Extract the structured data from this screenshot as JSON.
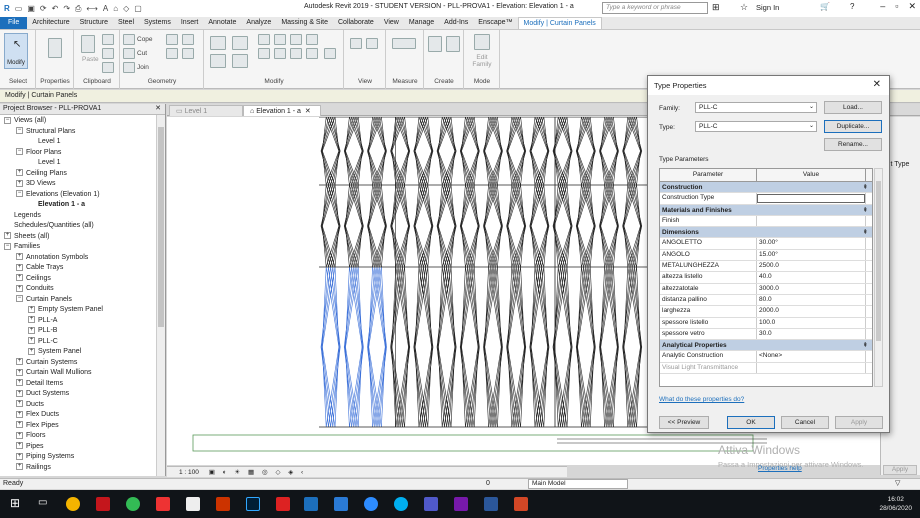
{
  "titlebar": {
    "title": "Autodesk Revit 2019 - STUDENT VERSION - PLL-PROVA1 - Elevation: Elevation 1 - a",
    "search_placeholder": "Type a keyword or phrase",
    "sign_in": "Sign In"
  },
  "tabs": [
    "File",
    "Architecture",
    "Structure",
    "Steel",
    "Systems",
    "Insert",
    "Annotate",
    "Analyze",
    "Massing & Site",
    "Collaborate",
    "View",
    "Manage",
    "Add-Ins",
    "Enscape™",
    "Modify | Curtain Panels"
  ],
  "ribbon": {
    "modify_label": "Modify",
    "cope": "Cope",
    "cut": "Cut",
    "join": "Join",
    "paste": "Paste",
    "edit_family": "Edit Family",
    "groups": [
      "Select",
      "Properties",
      "Clipboard",
      "Geometry",
      "Modify",
      "View",
      "Measure",
      "Create",
      "Mode"
    ]
  },
  "context_bar": "Modify | Curtain Panels",
  "project_browser": {
    "title": "Project Browser - PLL-PROVA1",
    "items": [
      {
        "label": "Views (all)",
        "level": 0,
        "exp": "-"
      },
      {
        "label": "Structural Plans",
        "level": 1,
        "exp": "-"
      },
      {
        "label": "Level 1",
        "level": 2,
        "exp": ""
      },
      {
        "label": "Floor Plans",
        "level": 1,
        "exp": "-"
      },
      {
        "label": "Level 1",
        "level": 2,
        "exp": ""
      },
      {
        "label": "Ceiling Plans",
        "level": 1,
        "exp": "+"
      },
      {
        "label": "3D Views",
        "level": 1,
        "exp": "+"
      },
      {
        "label": "Elevations (Elevation 1)",
        "level": 1,
        "exp": "-"
      },
      {
        "label": "Elevation 1 - a",
        "level": 2,
        "exp": "",
        "selected": true
      },
      {
        "label": "Legends",
        "level": 0,
        "exp": ""
      },
      {
        "label": "Schedules/Quantities (all)",
        "level": 0,
        "exp": ""
      },
      {
        "label": "Sheets (all)",
        "level": 0,
        "exp": "+"
      },
      {
        "label": "Families",
        "level": 0,
        "exp": "-"
      },
      {
        "label": "Annotation Symbols",
        "level": 1,
        "exp": "+"
      },
      {
        "label": "Cable Trays",
        "level": 1,
        "exp": "+"
      },
      {
        "label": "Ceilings",
        "level": 1,
        "exp": "+"
      },
      {
        "label": "Conduits",
        "level": 1,
        "exp": "+"
      },
      {
        "label": "Curtain Panels",
        "level": 1,
        "exp": "-"
      },
      {
        "label": "Empty System Panel",
        "level": 2,
        "exp": "+"
      },
      {
        "label": "PLL-A",
        "level": 2,
        "exp": "+"
      },
      {
        "label": "PLL-B",
        "level": 2,
        "exp": "+"
      },
      {
        "label": "PLL-C",
        "level": 2,
        "exp": "+"
      },
      {
        "label": "System Panel",
        "level": 2,
        "exp": "+"
      },
      {
        "label": "Curtain Systems",
        "level": 1,
        "exp": "+"
      },
      {
        "label": "Curtain Wall Mullions",
        "level": 1,
        "exp": "+"
      },
      {
        "label": "Detail Items",
        "level": 1,
        "exp": "+"
      },
      {
        "label": "Duct Systems",
        "level": 1,
        "exp": "+"
      },
      {
        "label": "Ducts",
        "level": 1,
        "exp": "+"
      },
      {
        "label": "Flex Ducts",
        "level": 1,
        "exp": "+"
      },
      {
        "label": "Flex Pipes",
        "level": 1,
        "exp": "+"
      },
      {
        "label": "Floors",
        "level": 1,
        "exp": "+"
      },
      {
        "label": "Pipes",
        "level": 1,
        "exp": "+"
      },
      {
        "label": "Piping Systems",
        "level": 1,
        "exp": "+"
      },
      {
        "label": "Railings",
        "level": 1,
        "exp": "+"
      }
    ]
  },
  "view_tabs": [
    "Level 1",
    "Elevation 1 - a"
  ],
  "view_bar": {
    "scale": "1 : 100"
  },
  "status": {
    "ready": "Ready",
    "zero": "0",
    "model": "Main Model"
  },
  "right_panel": {
    "edit_type": "dit Type",
    "apply": "Apply"
  },
  "watermark": {
    "line1": "Attiva Windows",
    "line2": "Passa a Impostazioni per attivare Windows."
  },
  "dialog": {
    "title": "Type Properties",
    "family_label": "Family:",
    "family_value": "PLL-C",
    "type_label": "Type:",
    "type_value": "PLL-C",
    "load": "Load...",
    "duplicate": "Duplicate...",
    "rename": "Rename...",
    "type_parameters": "Type Parameters",
    "col_parameter": "Parameter",
    "col_value": "Value",
    "rows": [
      {
        "group": "Construction"
      },
      {
        "name": "Construction Type",
        "value": ""
      },
      {
        "group": "Materials and Finishes"
      },
      {
        "name": "Finish",
        "value": ""
      },
      {
        "group": "Dimensions"
      },
      {
        "name": "ANGOLETTO",
        "value": "30.00°"
      },
      {
        "name": "ANGOLO",
        "value": "15.00°"
      },
      {
        "name": "METALUNGHEZZA",
        "value": "2500.0"
      },
      {
        "name": "altezza listello",
        "value": "40.0"
      },
      {
        "name": "altezzatotale",
        "value": "3000.0"
      },
      {
        "name": "distanza pallino",
        "value": "80.0"
      },
      {
        "name": "larghezza",
        "value": "2000.0"
      },
      {
        "name": "spessore listello",
        "value": "100.0"
      },
      {
        "name": "spessore vetro",
        "value": "30.0"
      },
      {
        "group": "Analytical Properties"
      },
      {
        "name": "Analytic Construction",
        "value": "<None>"
      },
      {
        "name": "Visual Light Transmittance",
        "value": "",
        "dim": true
      }
    ],
    "help_link": "What do these properties do?",
    "preview": "<< Preview",
    "ok": "OK",
    "cancel": "Cancel",
    "apply": "Apply",
    "behind_link": "Properties help"
  },
  "taskbar": {
    "time": "16:02",
    "date": "28/06/2020"
  }
}
